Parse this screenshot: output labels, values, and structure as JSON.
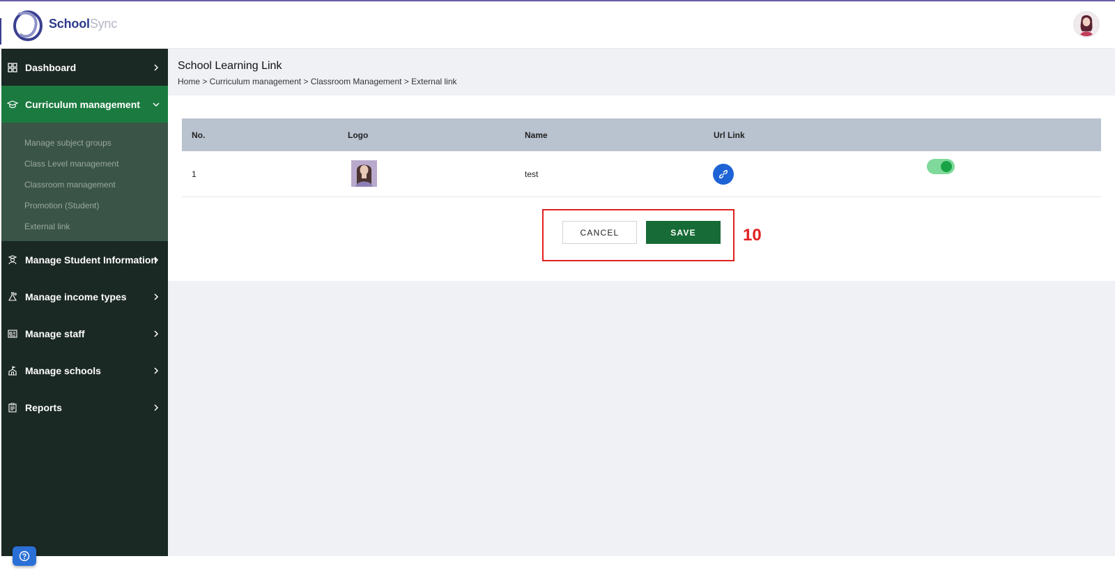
{
  "app": {
    "brand_part1": "School",
    "brand_part2": "Sync"
  },
  "sidebar": {
    "items": [
      {
        "label": "Dashboard",
        "icon": "grid-icon"
      },
      {
        "label": "Curriculum management",
        "icon": "graduation-cap-icon",
        "active": true
      },
      {
        "label": "Manage Student Information",
        "icon": "student-icon"
      },
      {
        "label": "Manage income types",
        "icon": "flask-icon"
      },
      {
        "label": "Manage staff",
        "icon": "id-card-icon"
      },
      {
        "label": "Manage schools",
        "icon": "school-icon"
      },
      {
        "label": "Reports",
        "icon": "clipboard-icon"
      }
    ],
    "submenu": [
      "Manage subject groups",
      "Class Level management",
      "Classroom management",
      "Promotion (Student)",
      "External link"
    ]
  },
  "page": {
    "title": "School Learning Link",
    "breadcrumb": "Home > Curriculum management > Classroom Management > External link"
  },
  "table": {
    "headers": [
      "No.",
      "Logo",
      "Name",
      "Url Link"
    ],
    "rows": [
      {
        "no": "1",
        "name": "test",
        "enabled": true
      }
    ]
  },
  "actions": {
    "cancel": "CANCEL",
    "save": "SAVE"
  },
  "annotation": "10",
  "colors": {
    "sidebar": "#1b2925",
    "active": "#1b7a3f",
    "save": "#176b36",
    "highlight": "#e02020",
    "link": "#1e63d6"
  }
}
